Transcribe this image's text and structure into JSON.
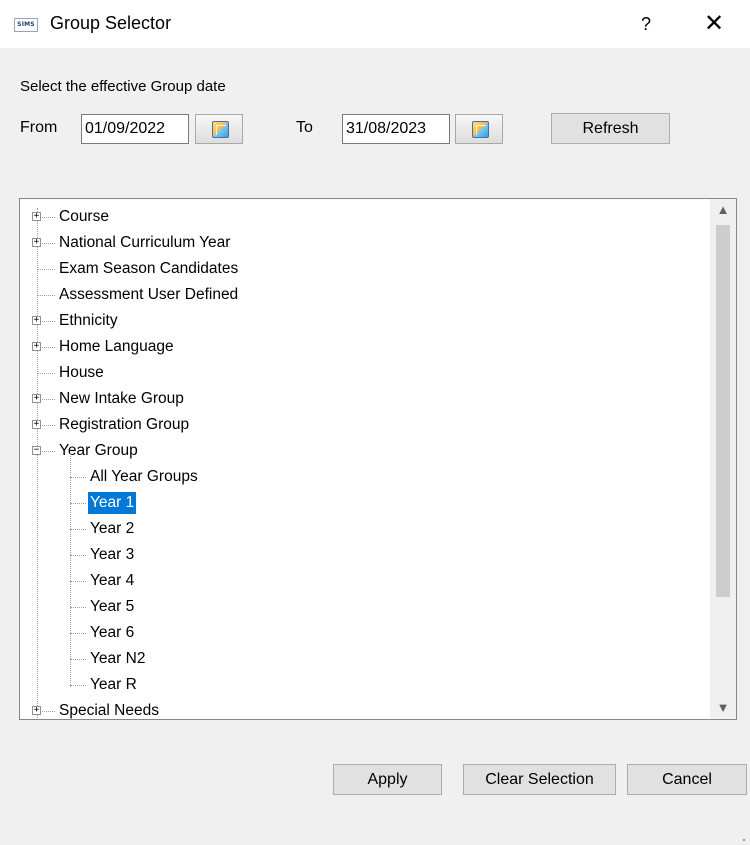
{
  "window": {
    "app_icon_text": "SIMS",
    "title": "Group Selector",
    "help_label": "?",
    "close_label": "✕"
  },
  "date_range": {
    "caption": "Select the effective Group date",
    "from_label": "From",
    "from_value": "01/09/2022",
    "to_label": "To",
    "to_value": "31/08/2023",
    "refresh_label": "Refresh"
  },
  "tree": {
    "items": [
      {
        "label": "Course",
        "expandable": true,
        "expanded": false
      },
      {
        "label": "National Curriculum Year",
        "expandable": true,
        "expanded": false
      },
      {
        "label": "Exam Season Candidates",
        "expandable": false
      },
      {
        "label": "Assessment User Defined",
        "expandable": false
      },
      {
        "label": "Ethnicity",
        "expandable": true,
        "expanded": false
      },
      {
        "label": "Home Language",
        "expandable": true,
        "expanded": false
      },
      {
        "label": "House",
        "expandable": false
      },
      {
        "label": "New Intake Group",
        "expandable": true,
        "expanded": false
      },
      {
        "label": "Registration Group",
        "expandable": true,
        "expanded": false
      },
      {
        "label": "Year Group",
        "expandable": true,
        "expanded": true,
        "children": [
          {
            "label": "All Year Groups"
          },
          {
            "label": "Year  1",
            "selected": true
          },
          {
            "label": "Year  2"
          },
          {
            "label": "Year  3"
          },
          {
            "label": "Year  4"
          },
          {
            "label": "Year  5"
          },
          {
            "label": "Year  6"
          },
          {
            "label": "Year  N2"
          },
          {
            "label": "Year  R"
          }
        ]
      },
      {
        "label": "Special Needs",
        "expandable": true,
        "expanded": false
      }
    ]
  },
  "colors": {
    "selection": "#0078d7",
    "dialog_bg": "#f0f0f0"
  },
  "footer": {
    "apply_label": "Apply",
    "clear_label": "Clear Selection",
    "cancel_label": "Cancel"
  }
}
